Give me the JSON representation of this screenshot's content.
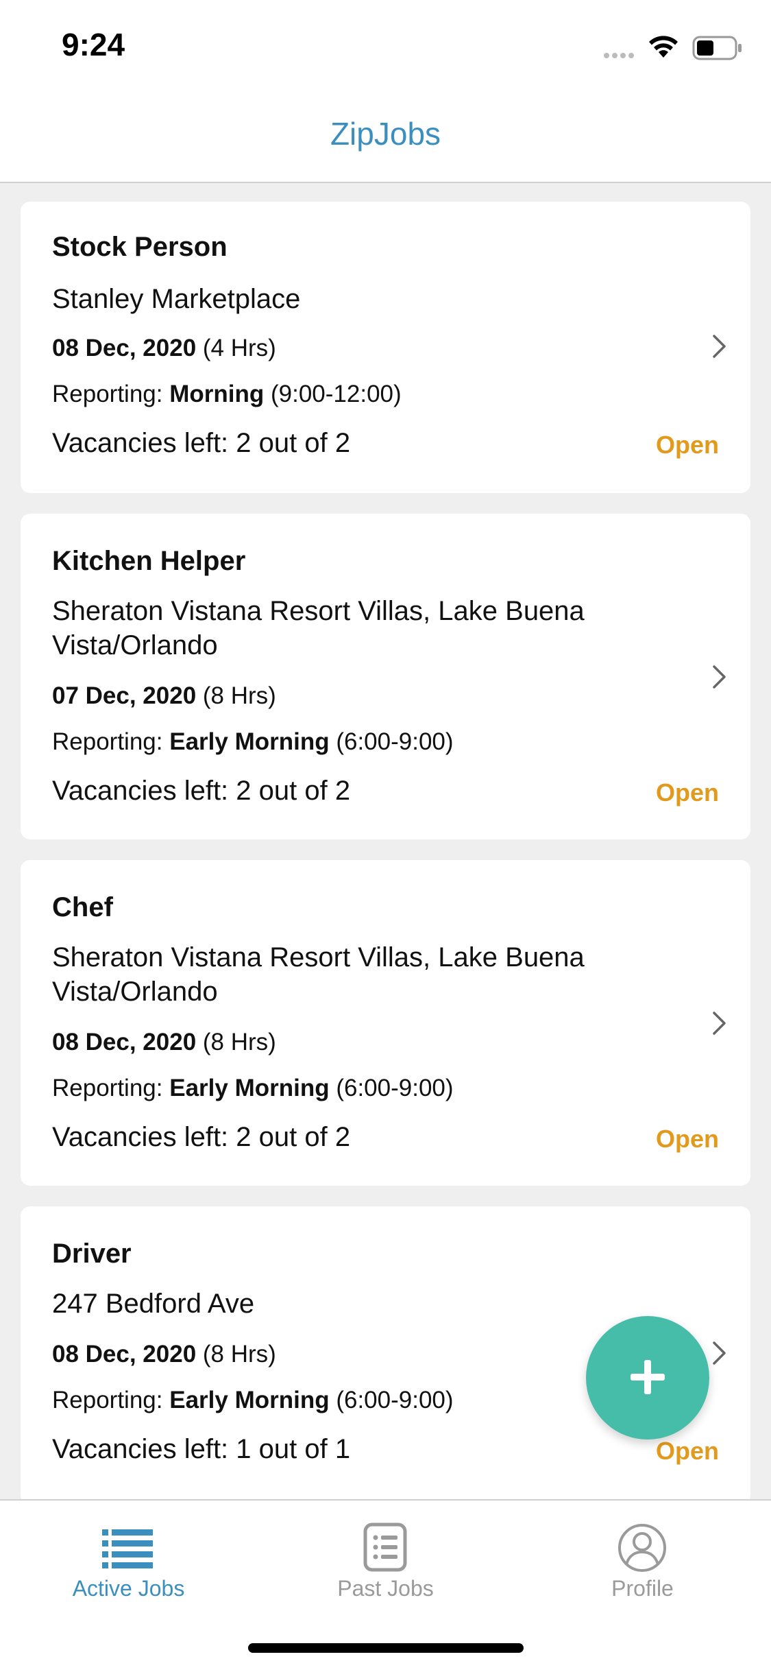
{
  "status_bar": {
    "time": "9:24"
  },
  "app": {
    "title": "ZipJobs"
  },
  "jobs": [
    {
      "title": "Stock Person",
      "location": "Stanley Marketplace",
      "date": "08 Dec, 2020",
      "duration": "(4 Hrs)",
      "reporting_label": "Reporting:",
      "reporting_period": "Morning",
      "reporting_time": "(9:00-12:00)",
      "vacancies": "Vacancies left: 2 out of 2",
      "status": "Open"
    },
    {
      "title": "Kitchen Helper",
      "location": "Sheraton Vistana Resort Villas, Lake Buena Vista/Orlando",
      "date": "07 Dec, 2020",
      "duration": "(8 Hrs)",
      "reporting_label": "Reporting:",
      "reporting_period": "Early Morning",
      "reporting_time": "(6:00-9:00)",
      "vacancies": "Vacancies left: 2 out of 2",
      "status": "Open"
    },
    {
      "title": "Chef",
      "location": "Sheraton Vistana Resort Villas, Lake Buena Vista/Orlando",
      "date": "08 Dec, 2020",
      "duration": "(8 Hrs)",
      "reporting_label": "Reporting:",
      "reporting_period": "Early Morning",
      "reporting_time": "(6:00-9:00)",
      "vacancies": "Vacancies left: 2 out of 2",
      "status": "Open"
    },
    {
      "title": "Driver",
      "location": "247 Bedford Ave",
      "date": "08 Dec, 2020",
      "duration": "(8 Hrs)",
      "reporting_label": "Reporting:",
      "reporting_period": "Early Morning",
      "reporting_time": "(6:00-9:00)",
      "vacancies": "Vacancies left: 1 out of 1",
      "status": "Open"
    }
  ],
  "fab": {
    "icon": "plus-icon"
  },
  "tabs": [
    {
      "label": "Active Jobs",
      "icon": "list-icon",
      "active": true
    },
    {
      "label": "Past Jobs",
      "icon": "clipboard-list-icon",
      "active": false
    },
    {
      "label": "Profile",
      "icon": "user-circle-icon",
      "active": false
    }
  ],
  "colors": {
    "accent": "#3b8fbf",
    "status_open": "#e29a1d",
    "fab": "#45bda8",
    "inactive_tab": "#9a9a9a"
  }
}
